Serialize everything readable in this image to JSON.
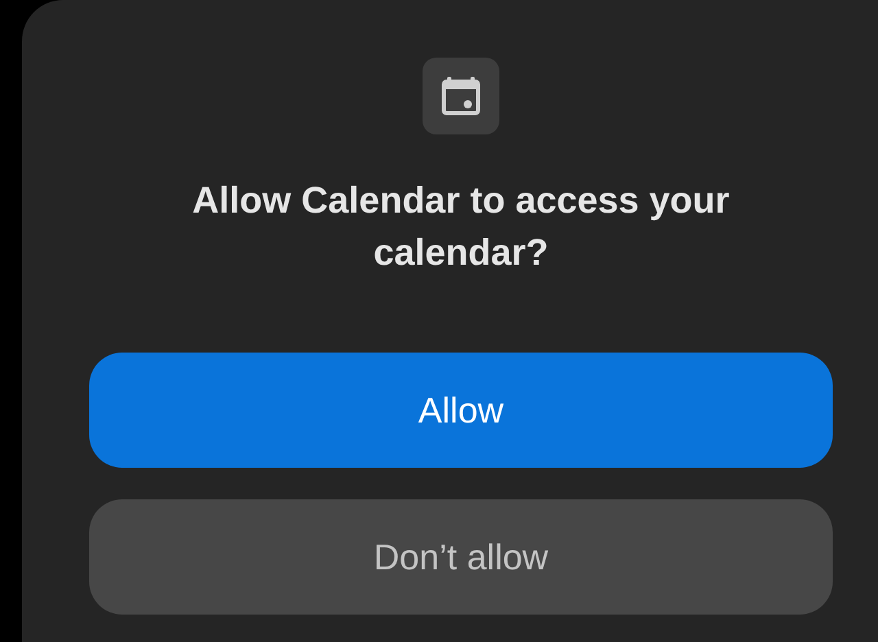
{
  "dialog": {
    "title": "Allow Calendar to access your calendar?",
    "buttons": [
      {
        "label": "Allow",
        "kind": "primary"
      },
      {
        "label": "Don’t allow",
        "kind": "secondary"
      }
    ]
  }
}
